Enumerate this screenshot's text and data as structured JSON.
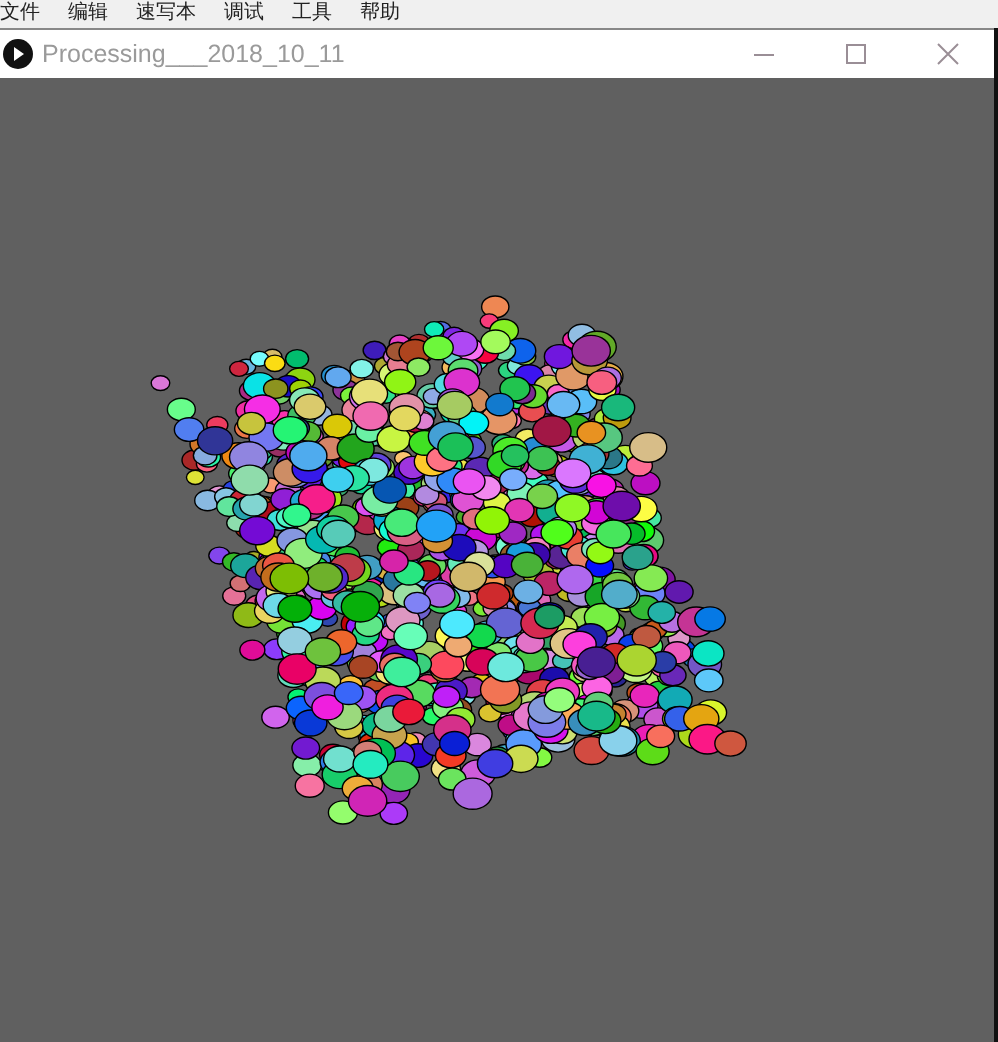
{
  "menu_bar": {
    "items": [
      "文件",
      "编辑",
      "速写本",
      "调试",
      "工具",
      "帮助"
    ]
  },
  "window": {
    "title": "Processing___2018_10_11"
  }
}
